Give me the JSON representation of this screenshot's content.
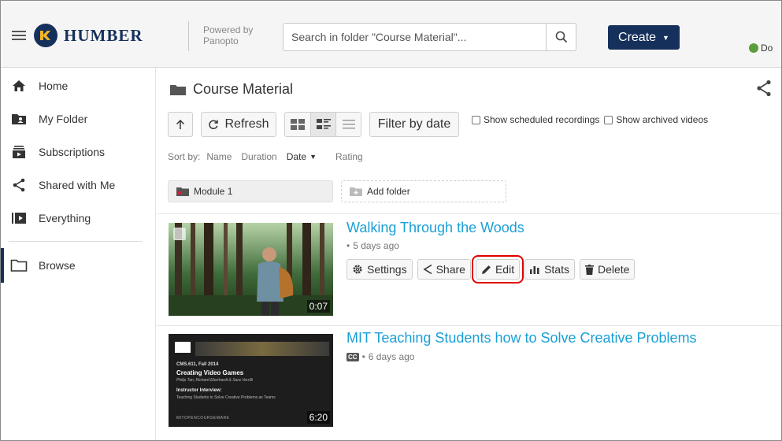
{
  "header": {
    "logo_text": "HUMBER",
    "powered_by": "Powered by Panopto",
    "search_placeholder": "Search in folder \"Course Material\"...",
    "create_label": "Create",
    "user_text": "Do",
    "brand_color": "#16305c"
  },
  "sidebar": {
    "items": [
      {
        "label": "Home",
        "icon": "home-icon"
      },
      {
        "label": "My Folder",
        "icon": "user-folder-icon"
      },
      {
        "label": "Subscriptions",
        "icon": "subscriptions-icon"
      },
      {
        "label": "Shared with Me",
        "icon": "share-icon"
      },
      {
        "label": "Everything",
        "icon": "everything-icon"
      },
      {
        "label": "Browse",
        "icon": "folder-icon",
        "active": true
      }
    ]
  },
  "main": {
    "folder_title": "Course Material",
    "toolbar": {
      "refresh_label": "Refresh",
      "filter_label": "Filter by date",
      "show_scheduled": "Show scheduled recordings",
      "show_archived": "Show archived videos"
    },
    "sort": {
      "label": "Sort by:",
      "options": [
        "Name",
        "Duration",
        "Date",
        "Rating"
      ],
      "active": "Date"
    },
    "folders": {
      "module": "Module 1",
      "add_folder": "Add folder"
    },
    "sessions": [
      {
        "title": "Walking Through the Woods",
        "meta": "5 days ago",
        "duration": "0:07",
        "actions": [
          "Settings",
          "Share",
          "Edit",
          "Stats",
          "Delete"
        ],
        "highlighted_action": "Edit"
      },
      {
        "title": "MIT Teaching Students how to Solve Creative Problems",
        "meta": "6 days ago",
        "duration": "6:20",
        "cc_label": "CC",
        "thumb": {
          "course": "CMS.611, Fall 2014",
          "name": "Creating Video Games",
          "people": "Philip Tan, Richard Eberhardt & Sara Verrilli",
          "interview": "Instructor Interview:",
          "topic": "Teaching Students to Solve Creative Problems as Teams",
          "footer": "MITOPENCOURSEWARE"
        }
      }
    ]
  },
  "colors": {
    "link": "#1a9fd6",
    "highlight": "#e00000"
  }
}
